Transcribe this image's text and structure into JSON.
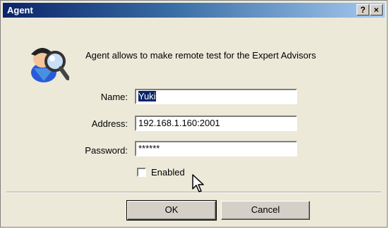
{
  "window": {
    "title": "Agent",
    "help_label": "?",
    "close_label": "×"
  },
  "dialog": {
    "icon": "agent-detective-icon",
    "message": "Agent allows to make remote test for the Expert Advisors"
  },
  "form": {
    "name": {
      "label": "Name:",
      "value": "Yuki"
    },
    "address": {
      "label": "Address:",
      "value": "192.168.1.160:2001"
    },
    "password": {
      "label": "Password:",
      "value": "******"
    },
    "enabled": {
      "label": "Enabled",
      "checked": false
    }
  },
  "buttons": {
    "ok": "OK",
    "cancel": "Cancel"
  },
  "colors": {
    "titlebar_start": "#0a246a",
    "titlebar_end": "#a6caf0",
    "dialog_bg": "#ece9d8"
  }
}
